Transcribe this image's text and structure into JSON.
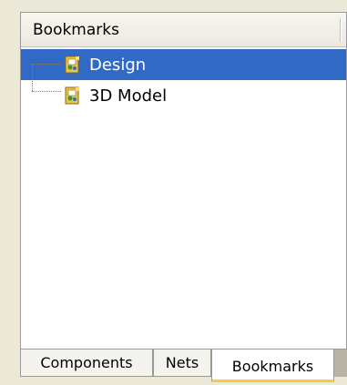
{
  "panel": {
    "header_title": "Bookmarks"
  },
  "tree": {
    "items": [
      {
        "label": "Design",
        "selected": true,
        "icon": "document-icon"
      },
      {
        "label": "3D Model",
        "selected": false,
        "icon": "document-icon"
      }
    ]
  },
  "tabs": [
    {
      "label": "Components",
      "active": false
    },
    {
      "label": "Nets",
      "active": false
    },
    {
      "label": "Bookmarks",
      "active": true
    }
  ],
  "colors": {
    "selection": "#316ac5",
    "active_tab_accent": "#ffc83c",
    "window_background": "#ece9d8"
  }
}
